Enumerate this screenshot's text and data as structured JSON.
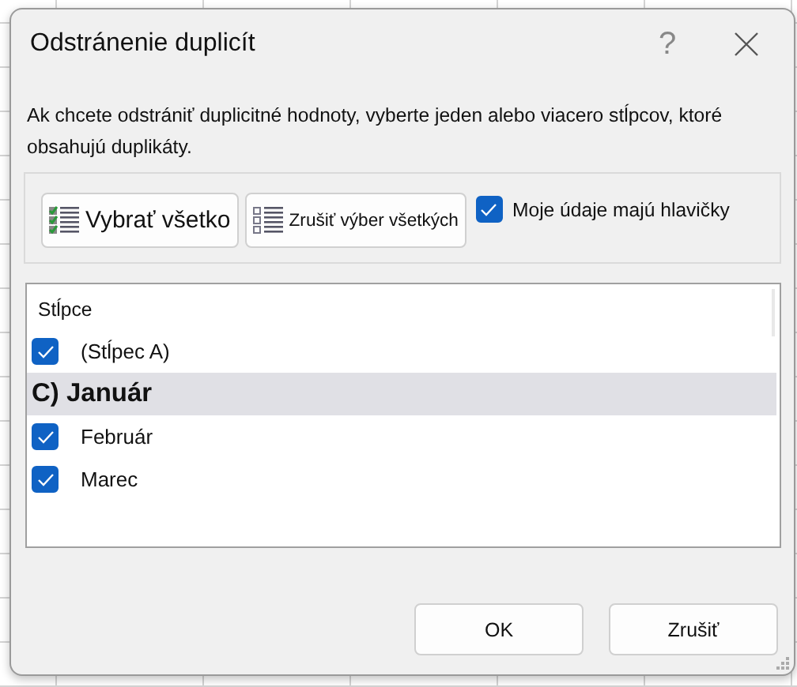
{
  "window": {
    "title": "Odstránenie duplicít",
    "help": "?"
  },
  "instruction": "Ak chcete odstrániť duplicitné hodnoty, vyberte jeden alebo viacero stĺpcov, ktoré obsahujú duplikáty.",
  "toolbar": {
    "select_all": "Vybrať všetko",
    "unselect_all": "Zrušiť výber všetkých",
    "headers": {
      "label": "Moje údaje majú hlavičky",
      "checked": true
    }
  },
  "columns": {
    "heading": "Stĺpce",
    "items": [
      {
        "label": "(Stĺpec A)",
        "kind": "checkbox",
        "checked": true,
        "selected": false
      },
      {
        "label": "C) Január",
        "kind": "plain",
        "selected": true
      },
      {
        "label": "Február",
        "kind": "checkbox",
        "checked": true,
        "selected": false
      },
      {
        "label": "Marec",
        "kind": "checkbox",
        "checked": true,
        "selected": false
      }
    ]
  },
  "buttons": [
    "OK",
    "Zrušiť"
  ]
}
